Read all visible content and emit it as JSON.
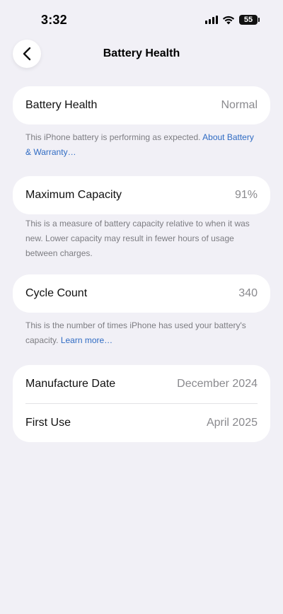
{
  "status_bar": {
    "time": "3:32",
    "battery_level": "55"
  },
  "nav": {
    "title": "Battery Health"
  },
  "battery_health": {
    "label": "Battery Health",
    "value": "Normal",
    "footnote": "This iPhone battery is performing as expected.",
    "footnote_link": "About Battery & Warranty…"
  },
  "max_capacity": {
    "label": "Maximum Capacity",
    "value": "91%",
    "footnote": "This is a measure of battery capacity relative to when it was new. Lower capacity may result in fewer hours of usage between charges."
  },
  "cycle_count": {
    "label": "Cycle Count",
    "value": "340",
    "footnote": "This is the number of times iPhone has used your battery's capacity.",
    "footnote_link": "Learn more…"
  },
  "dates": {
    "manufacture_label": "Manufacture Date",
    "manufacture_value": "December 2024",
    "first_use_label": "First Use",
    "first_use_value": "April 2025"
  },
  "colors": {
    "background": "#f1f0f6",
    "link": "#2f6bc3",
    "secondary_text": "#8a8a8e"
  }
}
